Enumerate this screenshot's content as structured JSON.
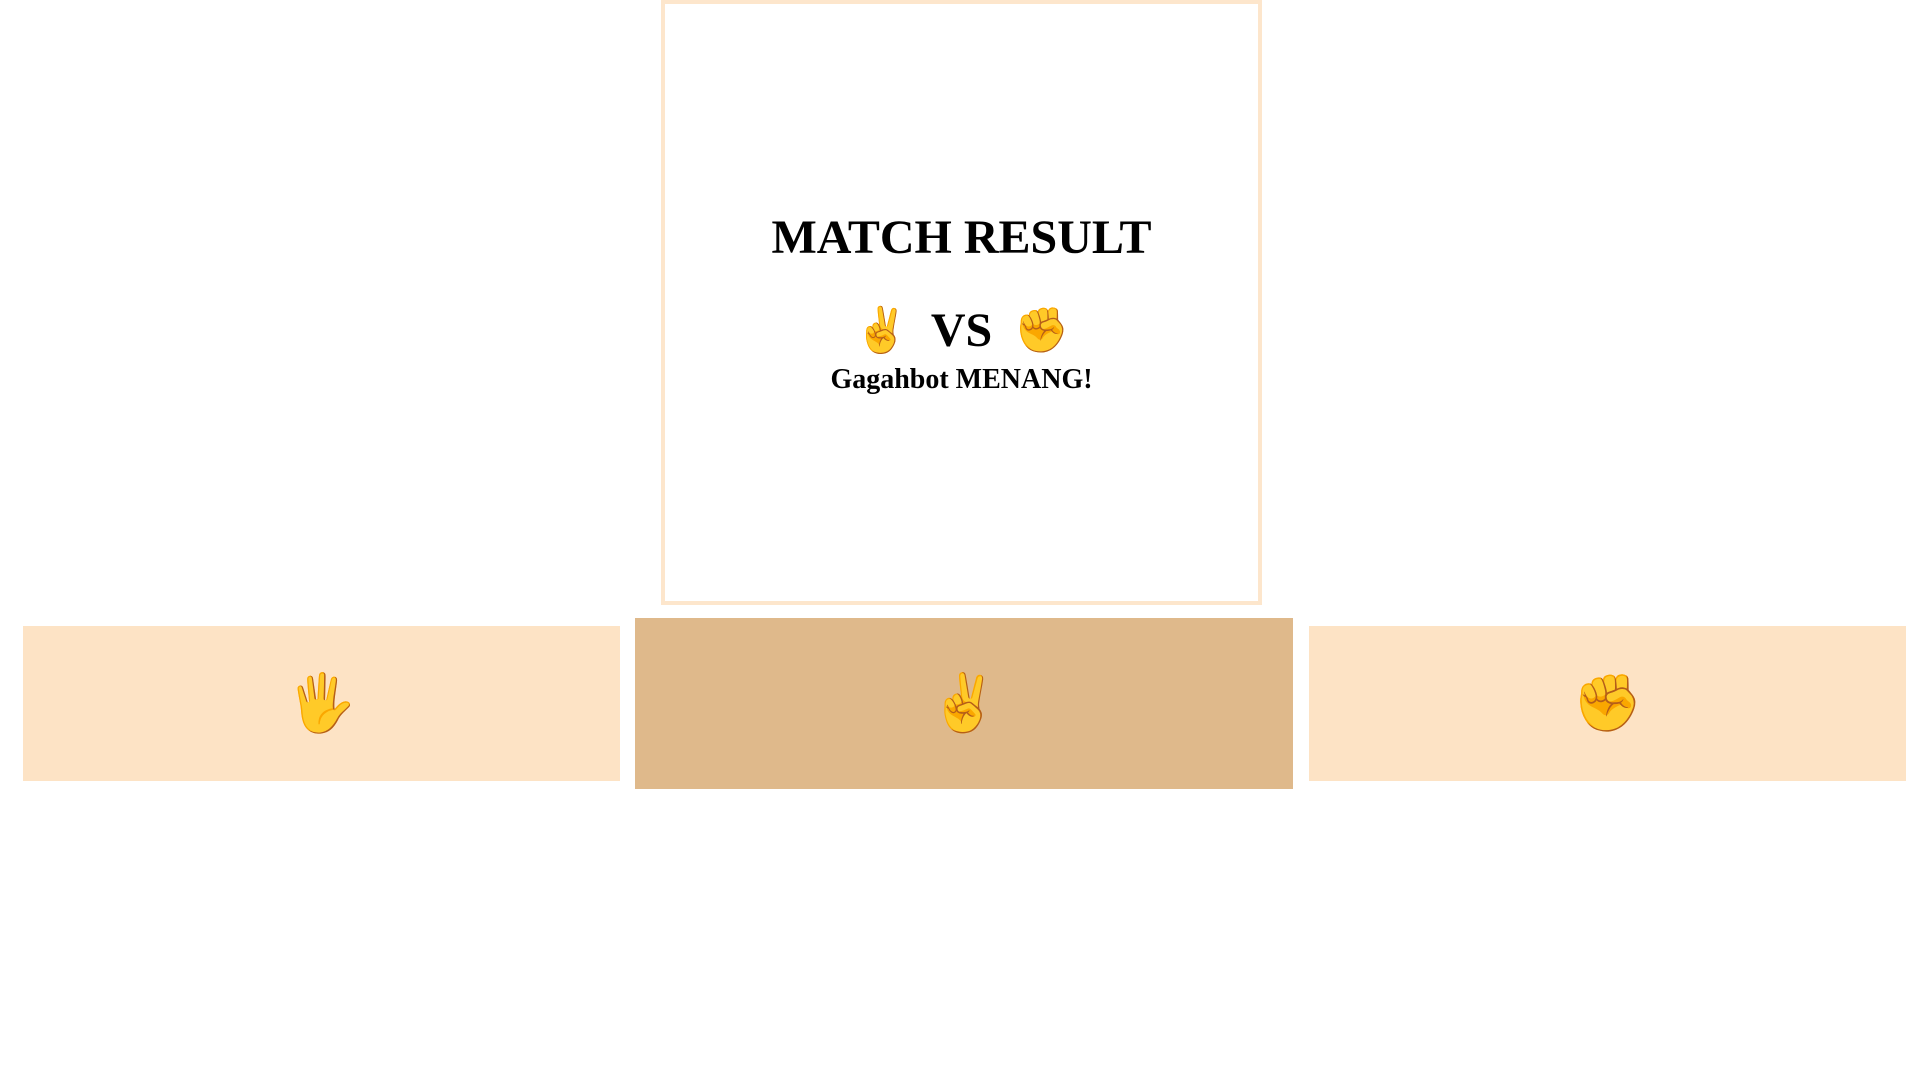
{
  "result_panel": {
    "title": "MATCH RESULT",
    "player_choice_icon": "✌️",
    "player_choice_name": "scissors-hand-icon",
    "vs_label": "VS",
    "bot_choice_icon": "✊",
    "bot_choice_name": "rock-fist-icon",
    "message": "Gagahbot MENANG!"
  },
  "choices": [
    {
      "name": "paper",
      "icon": "🖐️",
      "icon_name": "raised-hand-icon",
      "selected": false
    },
    {
      "name": "scissors",
      "icon": "✌️",
      "icon_name": "victory-hand-icon",
      "selected": true
    },
    {
      "name": "rock",
      "icon": "✊",
      "icon_name": "raised-fist-icon",
      "selected": false
    }
  ],
  "colors": {
    "panel_border": "#fde6cc",
    "button_bg": "#fde3c5",
    "button_selected_bg": "#dfb98b"
  }
}
